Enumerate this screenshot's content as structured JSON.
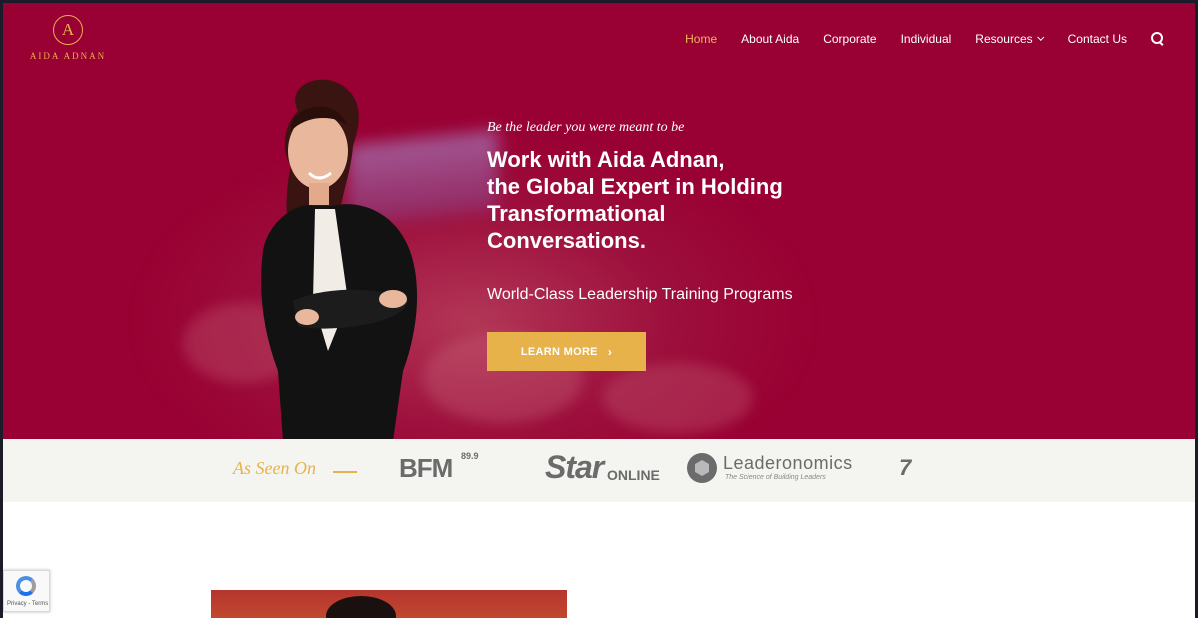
{
  "header": {
    "logo_letter": "A",
    "logo_name": "AIDA ADNAN",
    "nav": [
      {
        "label": "Home",
        "active": true
      },
      {
        "label": "About Aida"
      },
      {
        "label": "Corporate"
      },
      {
        "label": "Individual"
      },
      {
        "label": "Resources",
        "dropdown": true
      },
      {
        "label": "Contact Us"
      }
    ]
  },
  "hero": {
    "tagline": "Be the leader you were meant to be",
    "headline_lines": [
      "Work with Aida Adnan,",
      "the Global Expert in Holding",
      "Transformational",
      "Conversations."
    ],
    "subhead": "World-Class Leadership Training Programs",
    "cta_label": "LEARN MORE",
    "cta_arrow": "›"
  },
  "as_seen_on": {
    "label": "As Seen On",
    "logos": {
      "bfm": "BFM",
      "bfm_freq": "89.9",
      "star": "Star",
      "star_online": "ONLINE",
      "leaderonomics": "Leaderonomics",
      "leaderonomics_tagline": "The Science of Building Leaders"
    }
  },
  "recaptcha": {
    "footer": "Privacy - Terms"
  },
  "colors": {
    "brand": "#990033",
    "accent": "#e8b24a",
    "strip": "#f4f4f0"
  }
}
